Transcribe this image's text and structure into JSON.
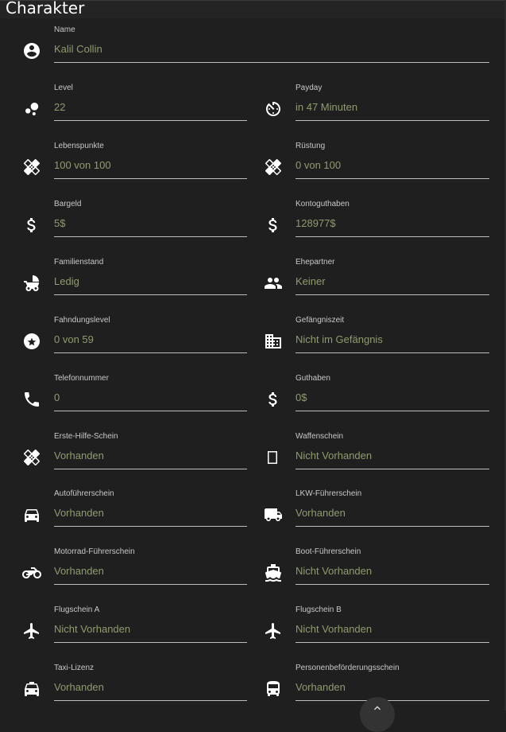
{
  "page": {
    "title": "Charakter"
  },
  "fields": [
    {
      "id": "name",
      "label": "Name",
      "value": "Kalil Collin",
      "icon": "account-circle-icon"
    },
    {
      "id": "level",
      "label": "Level",
      "value": "22",
      "icon": "bubble-chart-icon"
    },
    {
      "id": "payday",
      "label": "Payday",
      "value": "in 47 Minuten",
      "icon": "timer-icon"
    },
    {
      "id": "lebenspunkte",
      "label": "Lebenspunkte",
      "value": "100 von 100",
      "icon": "bandage-icon"
    },
    {
      "id": "ruestung",
      "label": "Rüstung",
      "value": "0 von 100",
      "icon": "bandage-icon"
    },
    {
      "id": "bargeld",
      "label": "Bargeld",
      "value": "5$",
      "icon": "dollar-icon"
    },
    {
      "id": "kontoguthaben",
      "label": "Kontoguthaben",
      "value": "128977$",
      "icon": "dollar-icon"
    },
    {
      "id": "familienstand",
      "label": "Familienstand",
      "value": "Ledig",
      "icon": "stroller-icon"
    },
    {
      "id": "ehepartner",
      "label": "Ehepartner",
      "value": "Keiner",
      "icon": "people-icon"
    },
    {
      "id": "fahndungslevel",
      "label": "Fahndungslevel",
      "value": "0 von 59",
      "icon": "star-circle-icon"
    },
    {
      "id": "gefaengniszeit",
      "label": "Gefängniszeit",
      "value": "Nicht im Gefängnis",
      "icon": "building-icon"
    },
    {
      "id": "telefonnummer",
      "label": "Telefonnummer",
      "value": "0",
      "icon": "phone-icon"
    },
    {
      "id": "guthaben",
      "label": "Guthaben",
      "value": "0$",
      "icon": "dollar-icon"
    },
    {
      "id": "erste-hilfe",
      "label": "Erste-Hilfe-Schein",
      "value": "Vorhanden",
      "icon": "bandage-icon"
    },
    {
      "id": "waffenschein",
      "label": "Waffenschein",
      "value": "Nicht Vorhanden",
      "icon": "missing-glyph-icon"
    },
    {
      "id": "autofuehrerschein",
      "label": "Autoführerschein",
      "value": "Vorhanden",
      "icon": "car-icon"
    },
    {
      "id": "lkw",
      "label": "LKW-Führerschein",
      "value": "Vorhanden",
      "icon": "truck-icon"
    },
    {
      "id": "motorrad",
      "label": "Motorrad-Führerschein",
      "value": "Vorhanden",
      "icon": "motorbike-icon"
    },
    {
      "id": "boot",
      "label": "Boot-Führerschein",
      "value": "Nicht Vorhanden",
      "icon": "ferry-icon"
    },
    {
      "id": "flugschein-a",
      "label": "Flugschein A",
      "value": "Nicht Vorhanden",
      "icon": "airplane-icon"
    },
    {
      "id": "flugschein-b",
      "label": "Flugschein B",
      "value": "Nicht Vorhanden",
      "icon": "airplane-icon"
    },
    {
      "id": "taxi",
      "label": "Taxi-Lizenz",
      "value": "Vorhanden",
      "icon": "taxi-icon"
    },
    {
      "id": "personenbefoerderung",
      "label": "Personenbeförderungsschein",
      "value": "Vorhanden",
      "icon": "bus-icon"
    }
  ],
  "colors": {
    "background": "#1f1f1f",
    "value": "#8f9c6e",
    "label": "#c8c8c8",
    "underline": "#bdbdbd"
  },
  "fab": {
    "icon": "chevron-up-icon"
  }
}
